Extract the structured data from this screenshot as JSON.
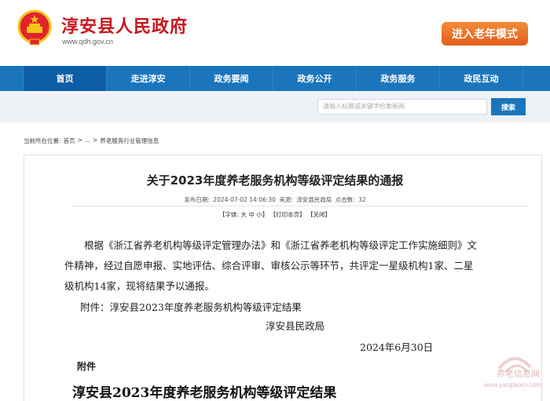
{
  "header": {
    "site_title": "淳安县人民政府",
    "site_url": "www.qdh.gov.cn",
    "elder_mode_label": "进入老年模式"
  },
  "nav": {
    "items": [
      {
        "label": "首页",
        "active": true
      },
      {
        "label": "走进淳安"
      },
      {
        "label": "政务要闻"
      },
      {
        "label": "政务公开"
      },
      {
        "label": "政务服务"
      },
      {
        "label": "政民互动"
      }
    ]
  },
  "search": {
    "placeholder": "请输入标题或关键字检索新闻",
    "button_label": "搜索"
  },
  "breadcrumb": {
    "prefix": "当前所在位置:",
    "items": [
      "首页",
      ">",
      "...",
      ">",
      "养老服务行业管理信息"
    ]
  },
  "article": {
    "title": "关于2023年度养老服务机构等级评定结果的通报",
    "meta": {
      "date_label": "发布日期:",
      "date": "2024-07-02 14:06:30",
      "source_label": "来源:",
      "source": "淳安县民政局",
      "views_label": "点击数:",
      "views": "32"
    },
    "tools": {
      "font_label": "【字体:",
      "font_large": "大",
      "font_medium": "中",
      "font_small": "小】",
      "print_label": "【打印本页】",
      "close_label": "【关闭】"
    },
    "paragraph": "根据《浙江省养老机构等级评定管理办法》和《浙江省养老机构等级评定工作实施细则》文件精神，经过自愿申报、实地评估、综合评审、审核公示等环节，共评定一星级机构1家、二星级机构14家，现将结果予以通报。",
    "attachment_line": "附件：淳安县2023年度养老服务机构等级评定结果",
    "signature_org": "淳安县民政局",
    "signature_date": "2024年6月30日",
    "attachment_heading": "附件",
    "attachment_title": "淳安县2023年度养老服务机构等级评定结果"
  },
  "watermark": {
    "text": "养老信息网",
    "url": "www.yanglaocn.com"
  },
  "colors": {
    "brand_red": "#c8161d",
    "nav_blue": "#1b75bc",
    "elder_orange": "#e35d1c"
  }
}
